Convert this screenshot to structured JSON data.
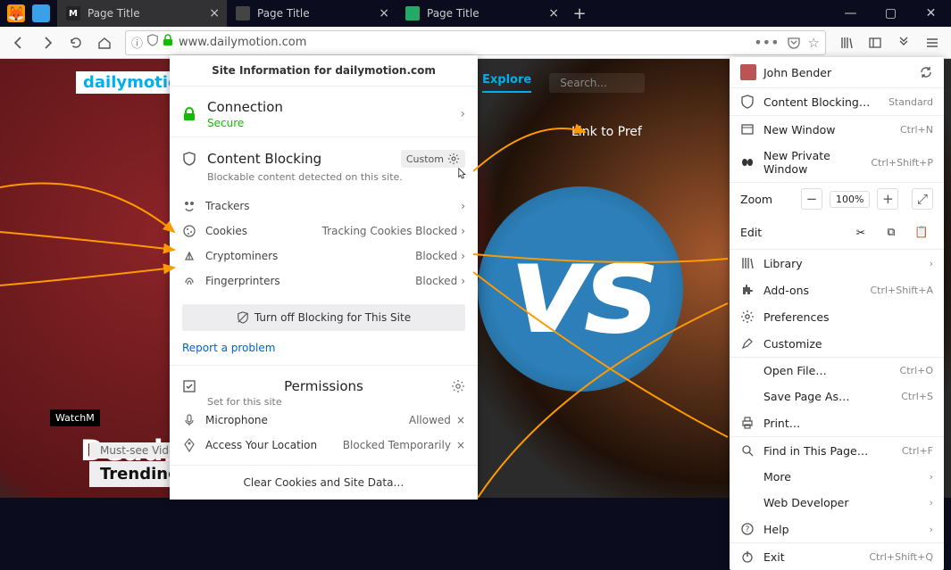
{
  "tabs": [
    {
      "label": "Page Title"
    },
    {
      "label": "Page Title"
    },
    {
      "label": "Page Title"
    }
  ],
  "url": "www.dailymotion.com",
  "brand": "dailymotion",
  "topnav": {
    "explore": "Explore",
    "search": "Search..."
  },
  "hero": {
    "vs": "vs",
    "title": "Deadpo",
    "mustsee": "Must-see Videos",
    "trending": "Trending",
    "watch": "WatchM"
  },
  "annotation": {
    "linkpref": "Link to Pref"
  },
  "sitePanel": {
    "header": "Site Information for dailymotion.com",
    "connection": {
      "title": "Connection",
      "status": "Secure"
    },
    "contentBlocking": {
      "title": "Content Blocking",
      "badge": "Custom",
      "note": "Blockable content detected on this site.",
      "items": [
        {
          "name": "Trackers",
          "status": ""
        },
        {
          "name": "Cookies",
          "status": "Tracking Cookies Blocked"
        },
        {
          "name": "Cryptominers",
          "status": "Blocked"
        },
        {
          "name": "Fingerprinters",
          "status": "Blocked"
        }
      ],
      "turnOff": "Turn off Blocking for This Site",
      "report": "Report a problem"
    },
    "permissions": {
      "title": "Permissions",
      "sub": "Set for this site",
      "items": [
        {
          "name": "Microphone",
          "status": "Allowed"
        },
        {
          "name": "Access Your Location",
          "status": "Blocked Temporarily"
        }
      ]
    },
    "clear": "Clear Cookies and Site Data…"
  },
  "menu": {
    "user": "John Bender",
    "contentBlocking": {
      "label": "Content Blocking…",
      "badge": "Standard"
    },
    "newWindow": {
      "label": "New Window",
      "sc": "Ctrl+N"
    },
    "newPrivate": {
      "label": "New Private Window",
      "sc": "Ctrl+Shift+P"
    },
    "zoom": {
      "label": "Zoom",
      "pct": "100%"
    },
    "edit": {
      "label": "Edit"
    },
    "library": "Library",
    "addons": {
      "label": "Add-ons",
      "sc": "Ctrl+Shift+A"
    },
    "preferences": "Preferences",
    "customize": "Customize",
    "openFile": {
      "label": "Open File…",
      "sc": "Ctrl+O"
    },
    "savePage": {
      "label": "Save Page As…",
      "sc": "Ctrl+S"
    },
    "print": "Print…",
    "find": {
      "label": "Find in This Page…",
      "sc": "Ctrl+F"
    },
    "more": "More",
    "webdev": "Web Developer",
    "help": "Help",
    "exit": {
      "label": "Exit",
      "sc": "Ctrl+Shift+Q"
    }
  }
}
